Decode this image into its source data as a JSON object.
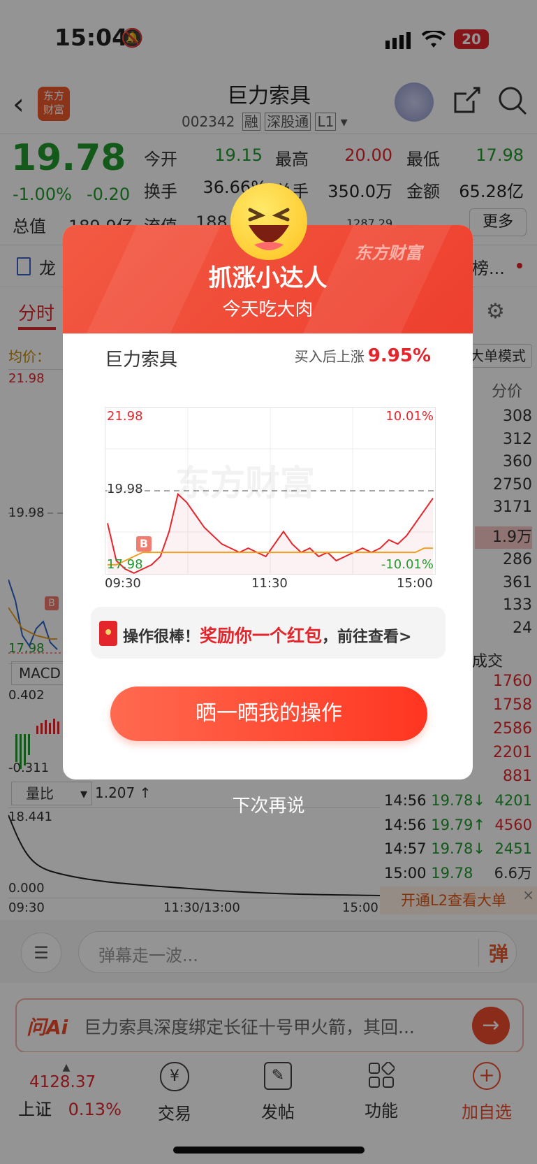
{
  "status_bar": {
    "time": "15:04",
    "battery": "20"
  },
  "header": {
    "title": "巨力索具",
    "code": "002342",
    "tags": [
      "融",
      "深股通",
      "L1"
    ],
    "logo_text": [
      "东方",
      "财富"
    ]
  },
  "quote": {
    "price": "19.78",
    "change_pct": "-1.00%",
    "change": "-0.20",
    "fields": [
      {
        "label": "今开",
        "value": "19.15"
      },
      {
        "label": "最高",
        "value": "20.00"
      },
      {
        "label": "最低",
        "value": "17.98"
      },
      {
        "label": "换手",
        "value": "36.66%"
      },
      {
        "label": "总手",
        "value": "350.0万"
      },
      {
        "label": "金额",
        "value": "65.28亿"
      }
    ],
    "row3": {
      "total_value_label": "总值",
      "total_value": "189.9亿",
      "float_label": "流值",
      "float_value": "188",
      "more_btn": "更多",
      "partial": "1287.29"
    }
  },
  "info_bar": {
    "left": "龙",
    "right": "榜..."
  },
  "tabs": {
    "active": "分时"
  },
  "chart_area": {
    "avg_label": "均价：",
    "high": "21.98",
    "mid": "19.98",
    "low": "17.98",
    "macd_label": "MACD",
    "macd_high": "0.402",
    "macd_low": "-0.311",
    "ratio_label": "量比",
    "ratio_value": "1.207 ↑",
    "ratio_high": "18.441",
    "ratio_low": "0.000",
    "times": [
      "09:30",
      "11:30/13:00",
      "15:00"
    ]
  },
  "side_panel": {
    "mode_label": "大单模式",
    "price_header": "分价",
    "prices": [
      "308",
      "312",
      "360",
      "2750",
      "3171",
      "1.9万",
      "286",
      "361",
      "133",
      "24"
    ],
    "trade_header": "成交",
    "trades": [
      "1760",
      "1758",
      "2586",
      "2201",
      "881"
    ],
    "ticks": [
      {
        "time": "14:56",
        "price": "19.78↓",
        "vol": "4201"
      },
      {
        "time": "14:56",
        "price": "19.79↑",
        "vol": "4560"
      },
      {
        "time": "14:57",
        "price": "19.78↓",
        "vol": "2451"
      },
      {
        "time": "15:00",
        "price": "19.78",
        "vol": "6.6万"
      }
    ],
    "l2_banner": "开通L2查看大单"
  },
  "comment_bar": {
    "placeholder": "弹幕走一波...",
    "danmu_btn": "弹"
  },
  "ai_bar": {
    "logo": "问Ai",
    "text": "巨力索具深度绑定长征十号甲火箭，其回..."
  },
  "bottom_nav": {
    "index_value": "4128.37",
    "index_name": "上证",
    "index_change": "0.13%",
    "items": [
      "交易",
      "发帖",
      "功能",
      "加自选"
    ]
  },
  "modal": {
    "title": "抓涨小达人",
    "subtitle": "今天吃大肉",
    "watermark_logo": "东方财富",
    "stock_name": "巨力索具",
    "gain_label": "买入后上涨",
    "gain_value": "9.95%",
    "chart": {
      "y_high": "21.98",
      "y_mid": "19.98",
      "y_low": "17.98",
      "pct_high": "10.01%",
      "pct_low": "-10.01%",
      "x_labels": [
        "09:30",
        "11:30",
        "15:00"
      ],
      "buy_marker": "B",
      "watermark": "东方财富"
    },
    "reward_prefix": "操作很棒！",
    "reward_highlight": "奖励你一个红包",
    "reward_suffix": "，前往查看>",
    "share_button": "晒一晒我的操作",
    "dismiss": "下次再说"
  },
  "colors": {
    "up": "#e4252b",
    "down": "#1f9a2e",
    "brand": "#ff4b2b"
  },
  "chart_data": {
    "type": "line",
    "title": "",
    "x": [
      "09:30",
      "11:30",
      "15:00"
    ],
    "series": [
      {
        "values": [
          19.2,
          18.3,
          18.1,
          18.0,
          18.1,
          18.2,
          18.4,
          19.0,
          19.9,
          19.7,
          19.4,
          19.1,
          18.9,
          18.7,
          18.6,
          18.5,
          18.6,
          18.5,
          18.4,
          18.7,
          19.0,
          18.7,
          18.5,
          18.6,
          18.4,
          18.5,
          18.3,
          18.4,
          18.5,
          18.6,
          18.5,
          18.6,
          18.8,
          18.7,
          18.9,
          19.2,
          19.5,
          19.8
        ]
      },
      {
        "values": [
          18.2,
          18.2,
          18.3,
          18.4,
          18.5,
          18.5,
          18.5,
          18.5,
          18.5,
          18.5,
          18.5,
          18.5,
          18.5,
          18.5,
          18.5,
          18.5,
          18.5,
          18.5,
          18.5,
          18.5,
          18.5,
          18.5,
          18.5,
          18.5,
          18.5,
          18.5,
          18.5,
          18.5,
          18.5,
          18.5,
          18.5,
          18.5,
          18.5,
          18.5,
          18.5,
          18.5,
          18.6,
          18.6
        ]
      }
    ],
    "ylim": [
      17.98,
      21.98
    ]
  }
}
